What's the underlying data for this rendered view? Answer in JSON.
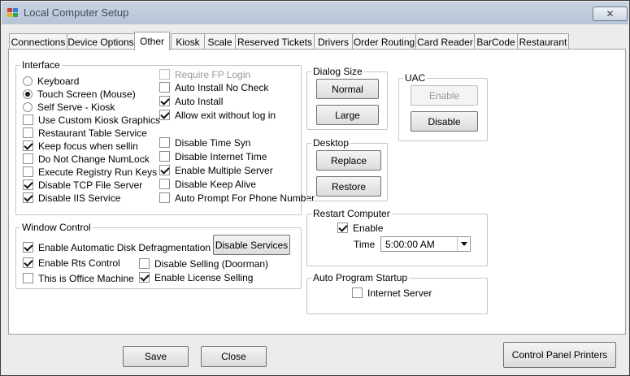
{
  "window": {
    "title": "Local Computer Setup"
  },
  "tabs": [
    "Connections",
    "Device Options",
    "Other",
    "Kiosk",
    "Scale",
    "Reserved Tickets",
    "Drivers",
    "Order Routing",
    "Card Reader",
    "BarCode",
    "Restaurant"
  ],
  "active_tab": "Other",
  "interface": {
    "legend": "Interface",
    "radios": [
      {
        "label": "Keyboard",
        "checked": false
      },
      {
        "label": "Touch Screen (Mouse)",
        "checked": true
      },
      {
        "label": "Self Serve - Kiosk",
        "checked": false
      }
    ],
    "left_checks": [
      {
        "label": "Use Custom Kiosk Graphics",
        "checked": false
      },
      {
        "label": "Restaurant Table Service",
        "checked": false
      },
      {
        "label": "Keep focus when sellin",
        "checked": true
      },
      {
        "label": "Do Not Change NumLock",
        "checked": false
      },
      {
        "label": "Execute Registry Run Keys",
        "checked": false
      },
      {
        "label": "Disable TCP File Server",
        "checked": true
      },
      {
        "label": "Disable IIS Service",
        "checked": true
      }
    ],
    "right_top_checks": [
      {
        "label": "Require FP Login",
        "checked": false,
        "disabled": true
      },
      {
        "label": "Auto Install No Check",
        "checked": false
      },
      {
        "label": "Auto Install",
        "checked": true
      },
      {
        "label": "Allow exit without log in",
        "checked": true
      }
    ],
    "right_bottom_checks": [
      {
        "label": "Disable Time Syn",
        "checked": false
      },
      {
        "label": "Disable Internet Time",
        "checked": false
      },
      {
        "label": "Enable Multiple Server",
        "checked": true
      },
      {
        "label": "Disable Keep Alive",
        "checked": false
      },
      {
        "label": "Auto Prompt For Phone Number",
        "checked": false
      }
    ]
  },
  "window_control": {
    "legend": "Window Control",
    "checks": [
      {
        "label": "Enable Automatic Disk Defragmentation",
        "checked": true
      },
      {
        "label": "Enable Rts Control",
        "checked": true
      },
      {
        "label": "This is Office Machine",
        "checked": false
      },
      {
        "label": "Disable Selling (Doorman)",
        "checked": false
      },
      {
        "label": "Enable License Selling",
        "checked": true
      }
    ],
    "disable_services_button": "Disable Services"
  },
  "dialog_size": {
    "legend": "Dialog Size",
    "normal_button": "Normal",
    "large_button": "Large"
  },
  "uac": {
    "legend": "UAC",
    "enable_button": "Enable",
    "disable_button": "Disable"
  },
  "desktop": {
    "legend": "Desktop",
    "replace_button": "Replace",
    "restore_button": "Restore"
  },
  "restart_computer": {
    "legend": "Restart Computer",
    "enable_label": "Enable",
    "enable_checked": true,
    "time_label": "Time",
    "time_value": "5:00:00 AM"
  },
  "auto_program_startup": {
    "legend": "Auto Program Startup",
    "internet_server_label": "Internet Server",
    "internet_server_checked": false
  },
  "footer": {
    "save_button": "Save",
    "close_button": "Close",
    "control_panel_printers_button": "Control Panel Printers"
  }
}
